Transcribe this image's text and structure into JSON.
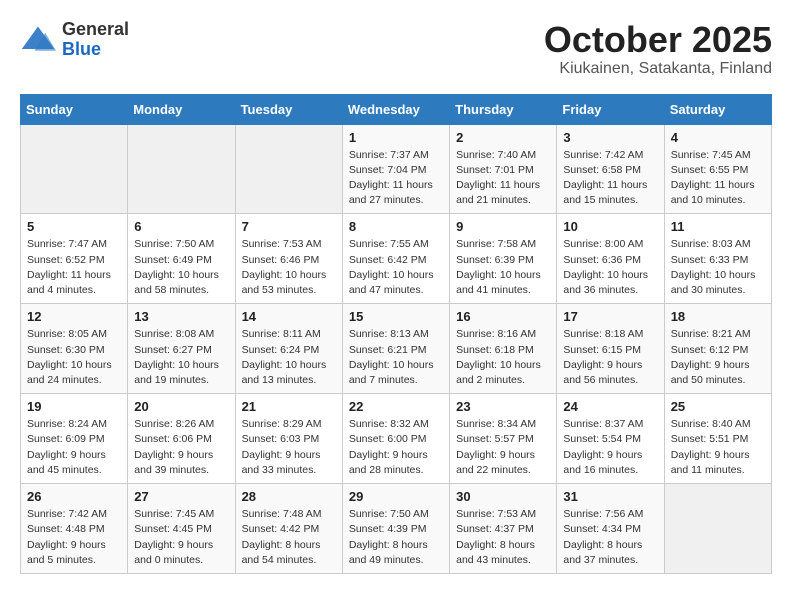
{
  "header": {
    "logo_general": "General",
    "logo_blue": "Blue",
    "month": "October 2025",
    "location": "Kiukainen, Satakanta, Finland"
  },
  "days_of_week": [
    "Sunday",
    "Monday",
    "Tuesday",
    "Wednesday",
    "Thursday",
    "Friday",
    "Saturday"
  ],
  "weeks": [
    [
      {
        "day": "",
        "sunrise": "",
        "sunset": "",
        "daylight": ""
      },
      {
        "day": "",
        "sunrise": "",
        "sunset": "",
        "daylight": ""
      },
      {
        "day": "",
        "sunrise": "",
        "sunset": "",
        "daylight": ""
      },
      {
        "day": "1",
        "sunrise": "Sunrise: 7:37 AM",
        "sunset": "Sunset: 7:04 PM",
        "daylight": "Daylight: 11 hours and 27 minutes."
      },
      {
        "day": "2",
        "sunrise": "Sunrise: 7:40 AM",
        "sunset": "Sunset: 7:01 PM",
        "daylight": "Daylight: 11 hours and 21 minutes."
      },
      {
        "day": "3",
        "sunrise": "Sunrise: 7:42 AM",
        "sunset": "Sunset: 6:58 PM",
        "daylight": "Daylight: 11 hours and 15 minutes."
      },
      {
        "day": "4",
        "sunrise": "Sunrise: 7:45 AM",
        "sunset": "Sunset: 6:55 PM",
        "daylight": "Daylight: 11 hours and 10 minutes."
      }
    ],
    [
      {
        "day": "5",
        "sunrise": "Sunrise: 7:47 AM",
        "sunset": "Sunset: 6:52 PM",
        "daylight": "Daylight: 11 hours and 4 minutes."
      },
      {
        "day": "6",
        "sunrise": "Sunrise: 7:50 AM",
        "sunset": "Sunset: 6:49 PM",
        "daylight": "Daylight: 10 hours and 58 minutes."
      },
      {
        "day": "7",
        "sunrise": "Sunrise: 7:53 AM",
        "sunset": "Sunset: 6:46 PM",
        "daylight": "Daylight: 10 hours and 53 minutes."
      },
      {
        "day": "8",
        "sunrise": "Sunrise: 7:55 AM",
        "sunset": "Sunset: 6:42 PM",
        "daylight": "Daylight: 10 hours and 47 minutes."
      },
      {
        "day": "9",
        "sunrise": "Sunrise: 7:58 AM",
        "sunset": "Sunset: 6:39 PM",
        "daylight": "Daylight: 10 hours and 41 minutes."
      },
      {
        "day": "10",
        "sunrise": "Sunrise: 8:00 AM",
        "sunset": "Sunset: 6:36 PM",
        "daylight": "Daylight: 10 hours and 36 minutes."
      },
      {
        "day": "11",
        "sunrise": "Sunrise: 8:03 AM",
        "sunset": "Sunset: 6:33 PM",
        "daylight": "Daylight: 10 hours and 30 minutes."
      }
    ],
    [
      {
        "day": "12",
        "sunrise": "Sunrise: 8:05 AM",
        "sunset": "Sunset: 6:30 PM",
        "daylight": "Daylight: 10 hours and 24 minutes."
      },
      {
        "day": "13",
        "sunrise": "Sunrise: 8:08 AM",
        "sunset": "Sunset: 6:27 PM",
        "daylight": "Daylight: 10 hours and 19 minutes."
      },
      {
        "day": "14",
        "sunrise": "Sunrise: 8:11 AM",
        "sunset": "Sunset: 6:24 PM",
        "daylight": "Daylight: 10 hours and 13 minutes."
      },
      {
        "day": "15",
        "sunrise": "Sunrise: 8:13 AM",
        "sunset": "Sunset: 6:21 PM",
        "daylight": "Daylight: 10 hours and 7 minutes."
      },
      {
        "day": "16",
        "sunrise": "Sunrise: 8:16 AM",
        "sunset": "Sunset: 6:18 PM",
        "daylight": "Daylight: 10 hours and 2 minutes."
      },
      {
        "day": "17",
        "sunrise": "Sunrise: 8:18 AM",
        "sunset": "Sunset: 6:15 PM",
        "daylight": "Daylight: 9 hours and 56 minutes."
      },
      {
        "day": "18",
        "sunrise": "Sunrise: 8:21 AM",
        "sunset": "Sunset: 6:12 PM",
        "daylight": "Daylight: 9 hours and 50 minutes."
      }
    ],
    [
      {
        "day": "19",
        "sunrise": "Sunrise: 8:24 AM",
        "sunset": "Sunset: 6:09 PM",
        "daylight": "Daylight: 9 hours and 45 minutes."
      },
      {
        "day": "20",
        "sunrise": "Sunrise: 8:26 AM",
        "sunset": "Sunset: 6:06 PM",
        "daylight": "Daylight: 9 hours and 39 minutes."
      },
      {
        "day": "21",
        "sunrise": "Sunrise: 8:29 AM",
        "sunset": "Sunset: 6:03 PM",
        "daylight": "Daylight: 9 hours and 33 minutes."
      },
      {
        "day": "22",
        "sunrise": "Sunrise: 8:32 AM",
        "sunset": "Sunset: 6:00 PM",
        "daylight": "Daylight: 9 hours and 28 minutes."
      },
      {
        "day": "23",
        "sunrise": "Sunrise: 8:34 AM",
        "sunset": "Sunset: 5:57 PM",
        "daylight": "Daylight: 9 hours and 22 minutes."
      },
      {
        "day": "24",
        "sunrise": "Sunrise: 8:37 AM",
        "sunset": "Sunset: 5:54 PM",
        "daylight": "Daylight: 9 hours and 16 minutes."
      },
      {
        "day": "25",
        "sunrise": "Sunrise: 8:40 AM",
        "sunset": "Sunset: 5:51 PM",
        "daylight": "Daylight: 9 hours and 11 minutes."
      }
    ],
    [
      {
        "day": "26",
        "sunrise": "Sunrise: 7:42 AM",
        "sunset": "Sunset: 4:48 PM",
        "daylight": "Daylight: 9 hours and 5 minutes."
      },
      {
        "day": "27",
        "sunrise": "Sunrise: 7:45 AM",
        "sunset": "Sunset: 4:45 PM",
        "daylight": "Daylight: 9 hours and 0 minutes."
      },
      {
        "day": "28",
        "sunrise": "Sunrise: 7:48 AM",
        "sunset": "Sunset: 4:42 PM",
        "daylight": "Daylight: 8 hours and 54 minutes."
      },
      {
        "day": "29",
        "sunrise": "Sunrise: 7:50 AM",
        "sunset": "Sunset: 4:39 PM",
        "daylight": "Daylight: 8 hours and 49 minutes."
      },
      {
        "day": "30",
        "sunrise": "Sunrise: 7:53 AM",
        "sunset": "Sunset: 4:37 PM",
        "daylight": "Daylight: 8 hours and 43 minutes."
      },
      {
        "day": "31",
        "sunrise": "Sunrise: 7:56 AM",
        "sunset": "Sunset: 4:34 PM",
        "daylight": "Daylight: 8 hours and 37 minutes."
      },
      {
        "day": "",
        "sunrise": "",
        "sunset": "",
        "daylight": ""
      }
    ]
  ]
}
